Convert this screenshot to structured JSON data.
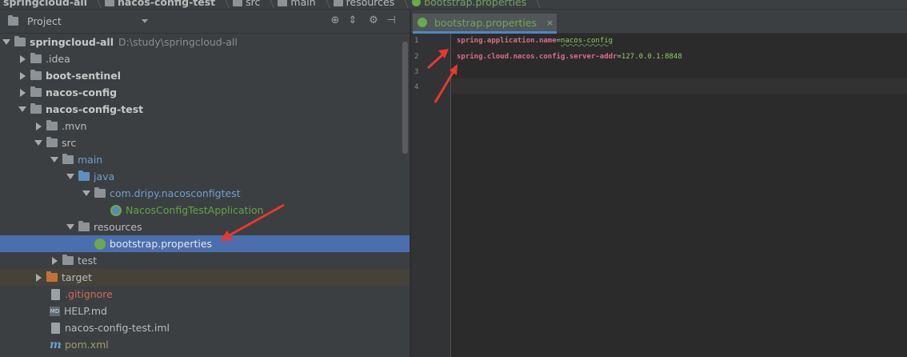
{
  "breadcrumb": {
    "items": [
      {
        "label": "springcloud-all",
        "bold": true
      },
      {
        "label": "nacos-config-test",
        "bold": true
      },
      {
        "label": "src"
      },
      {
        "label": "main"
      },
      {
        "label": "resources"
      },
      {
        "label": "bootstrap.properties"
      }
    ]
  },
  "project_panel": {
    "title": "Project",
    "tools": [
      "target-icon",
      "collapse-icon",
      "gear-icon",
      "hide-icon"
    ]
  },
  "tree": [
    {
      "label": "springcloud-all",
      "path": "D:\\study\\springcloud-all",
      "expanded": true
    },
    {
      "label": ".idea",
      "expanded": false
    },
    {
      "label": "boot-sentinel",
      "expanded": false
    },
    {
      "label": "nacos-config",
      "expanded": false
    },
    {
      "label": "nacos-config-test",
      "expanded": true
    },
    {
      "label": ".mvn",
      "expanded": false
    },
    {
      "label": "src",
      "expanded": true
    },
    {
      "label": "main",
      "expanded": true
    },
    {
      "label": "java",
      "expanded": true
    },
    {
      "label": "com.dripy.nacosconfigtest",
      "expanded": true
    },
    {
      "label": "NacosConfigTestApplication"
    },
    {
      "label": "resources",
      "expanded": true
    },
    {
      "label": "bootstrap.properties",
      "selected": true
    },
    {
      "label": "test",
      "expanded": false
    },
    {
      "label": "target",
      "expanded": false
    },
    {
      "label": ".gitignore"
    },
    {
      "label": "HELP.md"
    },
    {
      "label": "nacos-config-test.iml"
    },
    {
      "label": "pom.xml"
    }
  ],
  "editor": {
    "tab_label": "bootstrap.properties",
    "tab_close": "×",
    "line_numbers": [
      "1",
      "2",
      "3",
      "4"
    ],
    "lines": [
      {
        "key": "spring.application.name",
        "eq": "=",
        "value": "nacos-config"
      },
      {
        "key": "spring.cloud.nacos.config.server-addr",
        "eq": "=",
        "value": "127.0.0.1:8848"
      }
    ]
  },
  "colors": {
    "selection": "#4b6eaf",
    "annotation_arrow": "#e8382f",
    "key": "#e16b8c",
    "value": "#8fcf6a"
  }
}
